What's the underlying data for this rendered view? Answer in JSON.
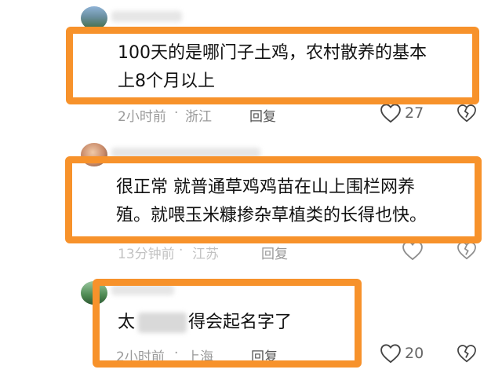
{
  "colors": {
    "highlight": "#F7922B",
    "meta": "#9a9a9a"
  },
  "comments": [
    {
      "text_lines": [
        "100天的是哪门子土鸡，农村散养的基本",
        "上8个月以上"
      ],
      "time": "2小时前",
      "location": "浙江",
      "reply_label": "回复",
      "likes": "27",
      "like_icon": "heart-outline-icon",
      "dislike_icon": "broken-heart-icon"
    },
    {
      "text_lines": [
        "很正常 就普通草鸡鸡苗在山上围栏网养",
        "殖。就喂玉米糠掺杂草植类的长得也快。"
      ],
      "time": "13分钟前",
      "location": "江苏",
      "reply_label": "回复",
      "likes": "",
      "like_icon": "heart-outline-icon",
      "dislike_icon": "broken-heart-icon"
    },
    {
      "text_start": "太",
      "text_end": "得会起名字了",
      "time": "2小时前",
      "location": "上海",
      "reply_label": "回复",
      "likes": "20",
      "like_icon": "heart-outline-icon",
      "dislike_icon": "broken-heart-icon"
    }
  ]
}
